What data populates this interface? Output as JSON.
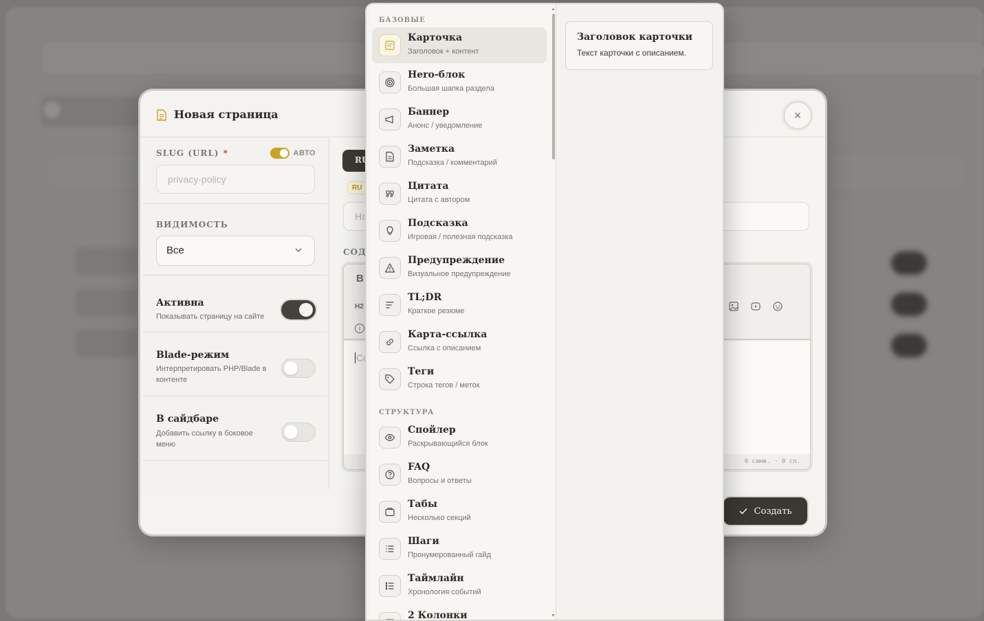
{
  "modal": {
    "title": "Новая страница",
    "close_glyph": "×",
    "slug": {
      "label": "SLUG (URL)",
      "required_mark": "*",
      "auto_label": "АВТО",
      "auto_on": true,
      "placeholder": "privacy-policy"
    },
    "visibility": {
      "label": "ВИДИМОСТЬ",
      "selected": "Все"
    },
    "options": [
      {
        "title": "Активна",
        "desc": "Показывать страницу на сайте",
        "on": true
      },
      {
        "title": "Blade-режим",
        "desc": "Интерпретировать PHP/Blade в контенте",
        "on": false
      },
      {
        "title": "В сайдбаре",
        "desc": "Добавить ссылку в боковое меню",
        "on": false
      }
    ],
    "lang_tab": "RU",
    "lang_badge": "RU",
    "title_input_placeholder": "На",
    "content_label": "СОДІ",
    "editor": {
      "bold": "B",
      "h2": "H2",
      "info": "i",
      "placeholder": "Co",
      "footer": "0 симв. · 0 сл."
    },
    "create_button": "Создать"
  },
  "picker": {
    "groups": [
      {
        "label": "БАЗОВЫЕ",
        "items": [
          {
            "title": "Карточка",
            "desc": "Заголовок + контент",
            "icon": "card-icon",
            "selected": true
          },
          {
            "title": "Hero-блок",
            "desc": "Большая шапка раздела",
            "icon": "target-icon"
          },
          {
            "title": "Баннер",
            "desc": "Анонс / уведомление",
            "icon": "megaphone-icon"
          },
          {
            "title": "Заметка",
            "desc": "Подсказка / комментарий",
            "icon": "document-icon"
          },
          {
            "title": "Цитата",
            "desc": "Цитата с автором",
            "icon": "quote-icon"
          },
          {
            "title": "Подсказка",
            "desc": "Игровая / полезная подсказка",
            "icon": "lightbulb-icon"
          },
          {
            "title": "Предупреждение",
            "desc": "Визуальное предупреждение",
            "icon": "warning-icon"
          },
          {
            "title": "TL;DR",
            "desc": "Краткое резюме",
            "icon": "lines-icon"
          },
          {
            "title": "Карта-ссылка",
            "desc": "Ссылка с описанием",
            "icon": "link-icon"
          },
          {
            "title": "Теги",
            "desc": "Строка тегов / меток",
            "icon": "tag-icon"
          }
        ]
      },
      {
        "label": "СТРУКТУРА",
        "items": [
          {
            "title": "Спойлер",
            "desc": "Раскрывающийся блок",
            "icon": "eye-icon"
          },
          {
            "title": "FAQ",
            "desc": "Вопросы и ответы",
            "icon": "question-icon"
          },
          {
            "title": "Табы",
            "desc": "Несколько секций",
            "icon": "folder-icon"
          },
          {
            "title": "Шаги",
            "desc": "Пронумерованный гайд",
            "icon": "list-icon"
          },
          {
            "title": "Таймлайн",
            "desc": "Хронология событий",
            "icon": "timeline-icon"
          },
          {
            "title": "2 Колонки",
            "desc": "",
            "icon": "columns-icon"
          }
        ]
      }
    ],
    "preview": {
      "title": "Заголовок карточки",
      "text": "Текст карточки с описанием."
    }
  }
}
